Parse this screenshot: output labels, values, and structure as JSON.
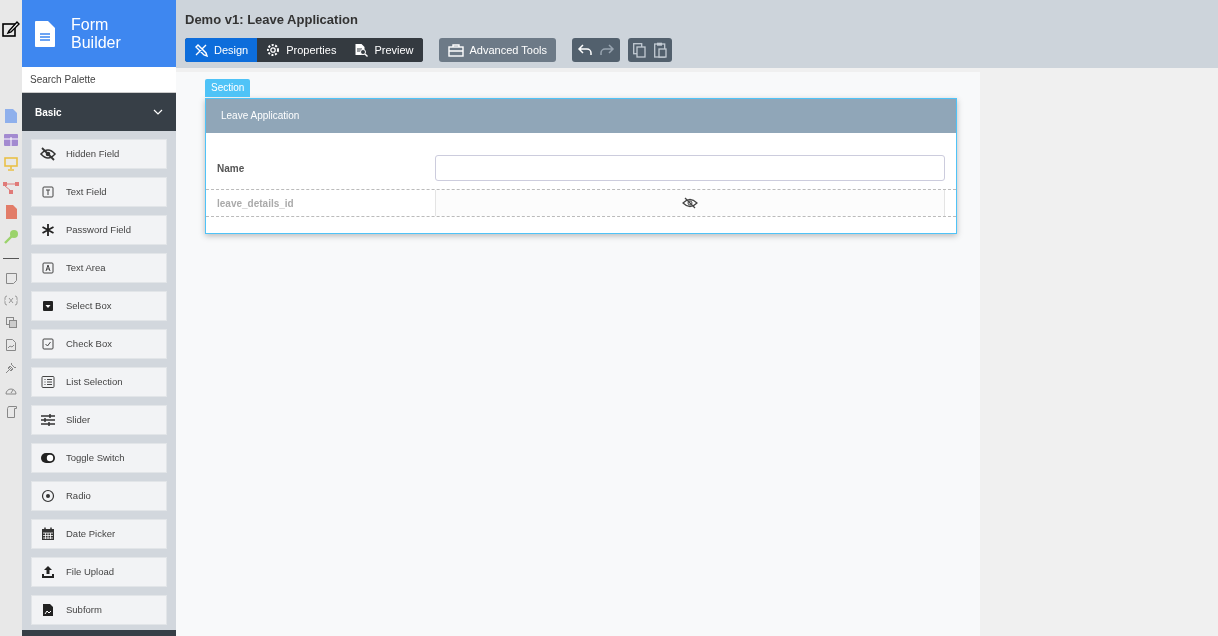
{
  "app": {
    "title_line1": "Form",
    "title_line2": "Builder"
  },
  "palette": {
    "search_placeholder": "Search Palette",
    "group": {
      "label": "Basic",
      "expanded": true
    },
    "items": [
      {
        "kind": "hidden",
        "label": "Hidden Field"
      },
      {
        "kind": "text",
        "label": "Text Field"
      },
      {
        "kind": "password",
        "label": "Password Field"
      },
      {
        "kind": "textarea",
        "label": "Text Area"
      },
      {
        "kind": "select",
        "label": "Select Box"
      },
      {
        "kind": "checkbox",
        "label": "Check Box"
      },
      {
        "kind": "list",
        "label": "List Selection"
      },
      {
        "kind": "slider",
        "label": "Slider"
      },
      {
        "kind": "toggle",
        "label": "Toggle Switch"
      },
      {
        "kind": "radio",
        "label": "Radio"
      },
      {
        "kind": "date",
        "label": "Date Picker"
      },
      {
        "kind": "upload",
        "label": "File Upload"
      },
      {
        "kind": "subform",
        "label": "Subform"
      }
    ]
  },
  "header": {
    "title": "Demo v1: Leave Application"
  },
  "tabs": [
    {
      "label": "Design",
      "selected": true
    },
    {
      "label": "Properties",
      "selected": false
    },
    {
      "label": "Preview",
      "selected": false
    }
  ],
  "advanced_button": "Advanced Tools",
  "history": [
    {
      "kind": "undo",
      "disabled": false
    },
    {
      "kind": "redo",
      "disabled": true
    }
  ],
  "section": {
    "tab": "Section",
    "title": "Leave Application",
    "fields": [
      {
        "kind": "input",
        "label": "Name"
      },
      {
        "kind": "hidden",
        "label": "leave_details_id"
      }
    ]
  }
}
